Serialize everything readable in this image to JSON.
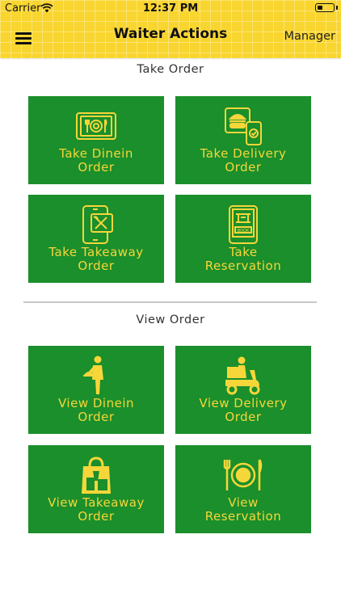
{
  "status_bar": {
    "carrier": "Carrier",
    "time": "12:37 PM"
  },
  "nav": {
    "title": "Waiter Actions",
    "right_button": "Manager",
    "menu_icon": "hamburger-menu-icon"
  },
  "take_order": {
    "title": "Take Order",
    "tiles": [
      {
        "label": "Take Dinein\nOrder",
        "icon": "tablet-dining-icon"
      },
      {
        "label": "Take Delivery\nOrder",
        "icon": "burger-phone-icon"
      },
      {
        "label": "Take Takeaway\nOrder",
        "icon": "phone-utensils-icon"
      },
      {
        "label": "Take\nReservation",
        "icon": "tablet-book-icon"
      }
    ]
  },
  "view_order": {
    "title": "View Order",
    "tiles": [
      {
        "label": "View Dinein\nOrder",
        "icon": "waiter-icon"
      },
      {
        "label": "View Delivery\nOrder",
        "icon": "delivery-scooter-icon"
      },
      {
        "label": "View Takeaway\nOrder",
        "icon": "takeaway-bag-icon"
      },
      {
        "label": "View\nReservation",
        "icon": "plate-cutlery-icon"
      }
    ]
  },
  "colors": {
    "header": "#f9d52f",
    "tile": "#1a8f2b",
    "tile_text": "#f7d63a"
  }
}
